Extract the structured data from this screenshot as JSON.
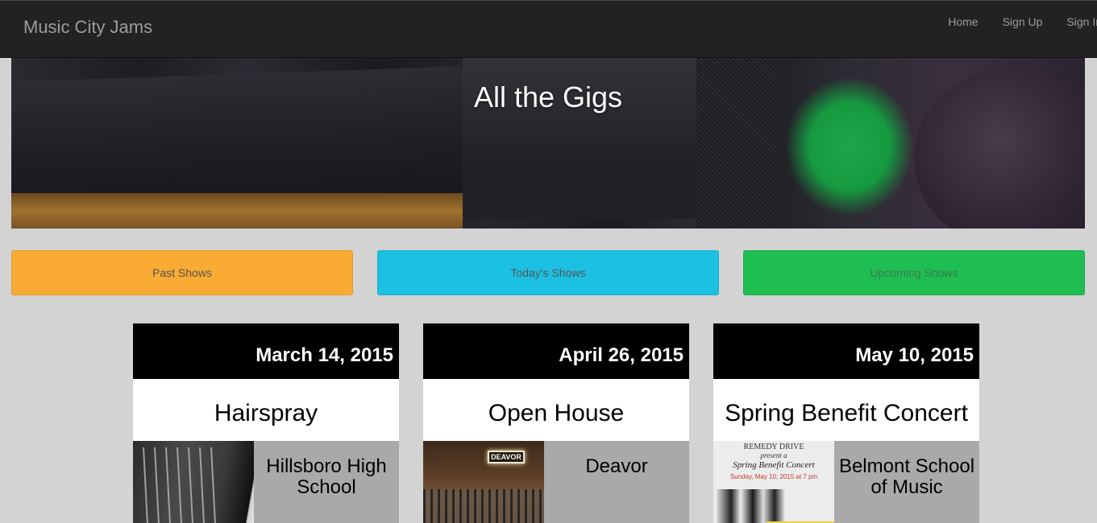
{
  "navbar": {
    "brand": "Music City Jams",
    "links": [
      "Home",
      "Sign Up",
      "Sign In"
    ]
  },
  "hero": {
    "title": "All the Gigs"
  },
  "filters": {
    "past": "Past Shows",
    "today": "Today's Shows",
    "upcoming": "Upcoming Shows"
  },
  "colors": {
    "navbar": "#222222",
    "past": "#f9ab34",
    "today": "#1cc0e2",
    "upcoming": "#1ebe52",
    "page_background": "#d3d3d3"
  },
  "gigs": [
    {
      "date": "March 14, 2015",
      "title": "Hairspray",
      "venue": "Hillsboro High School"
    },
    {
      "date": "April 26, 2015",
      "title": "Open House",
      "venue": "Deavor"
    },
    {
      "date": "May 10, 2015",
      "title": "Spring Benefit Concert",
      "venue": "Belmont School of Music"
    }
  ],
  "images": {
    "deavor_sign": "DEAVOR",
    "poster": {
      "line1": "REMEDY DRIVE",
      "line2": "present a",
      "line3": "Spring Benefit Concert",
      "line4": "Sunday, May 10, 2015 at 7 pm"
    }
  }
}
